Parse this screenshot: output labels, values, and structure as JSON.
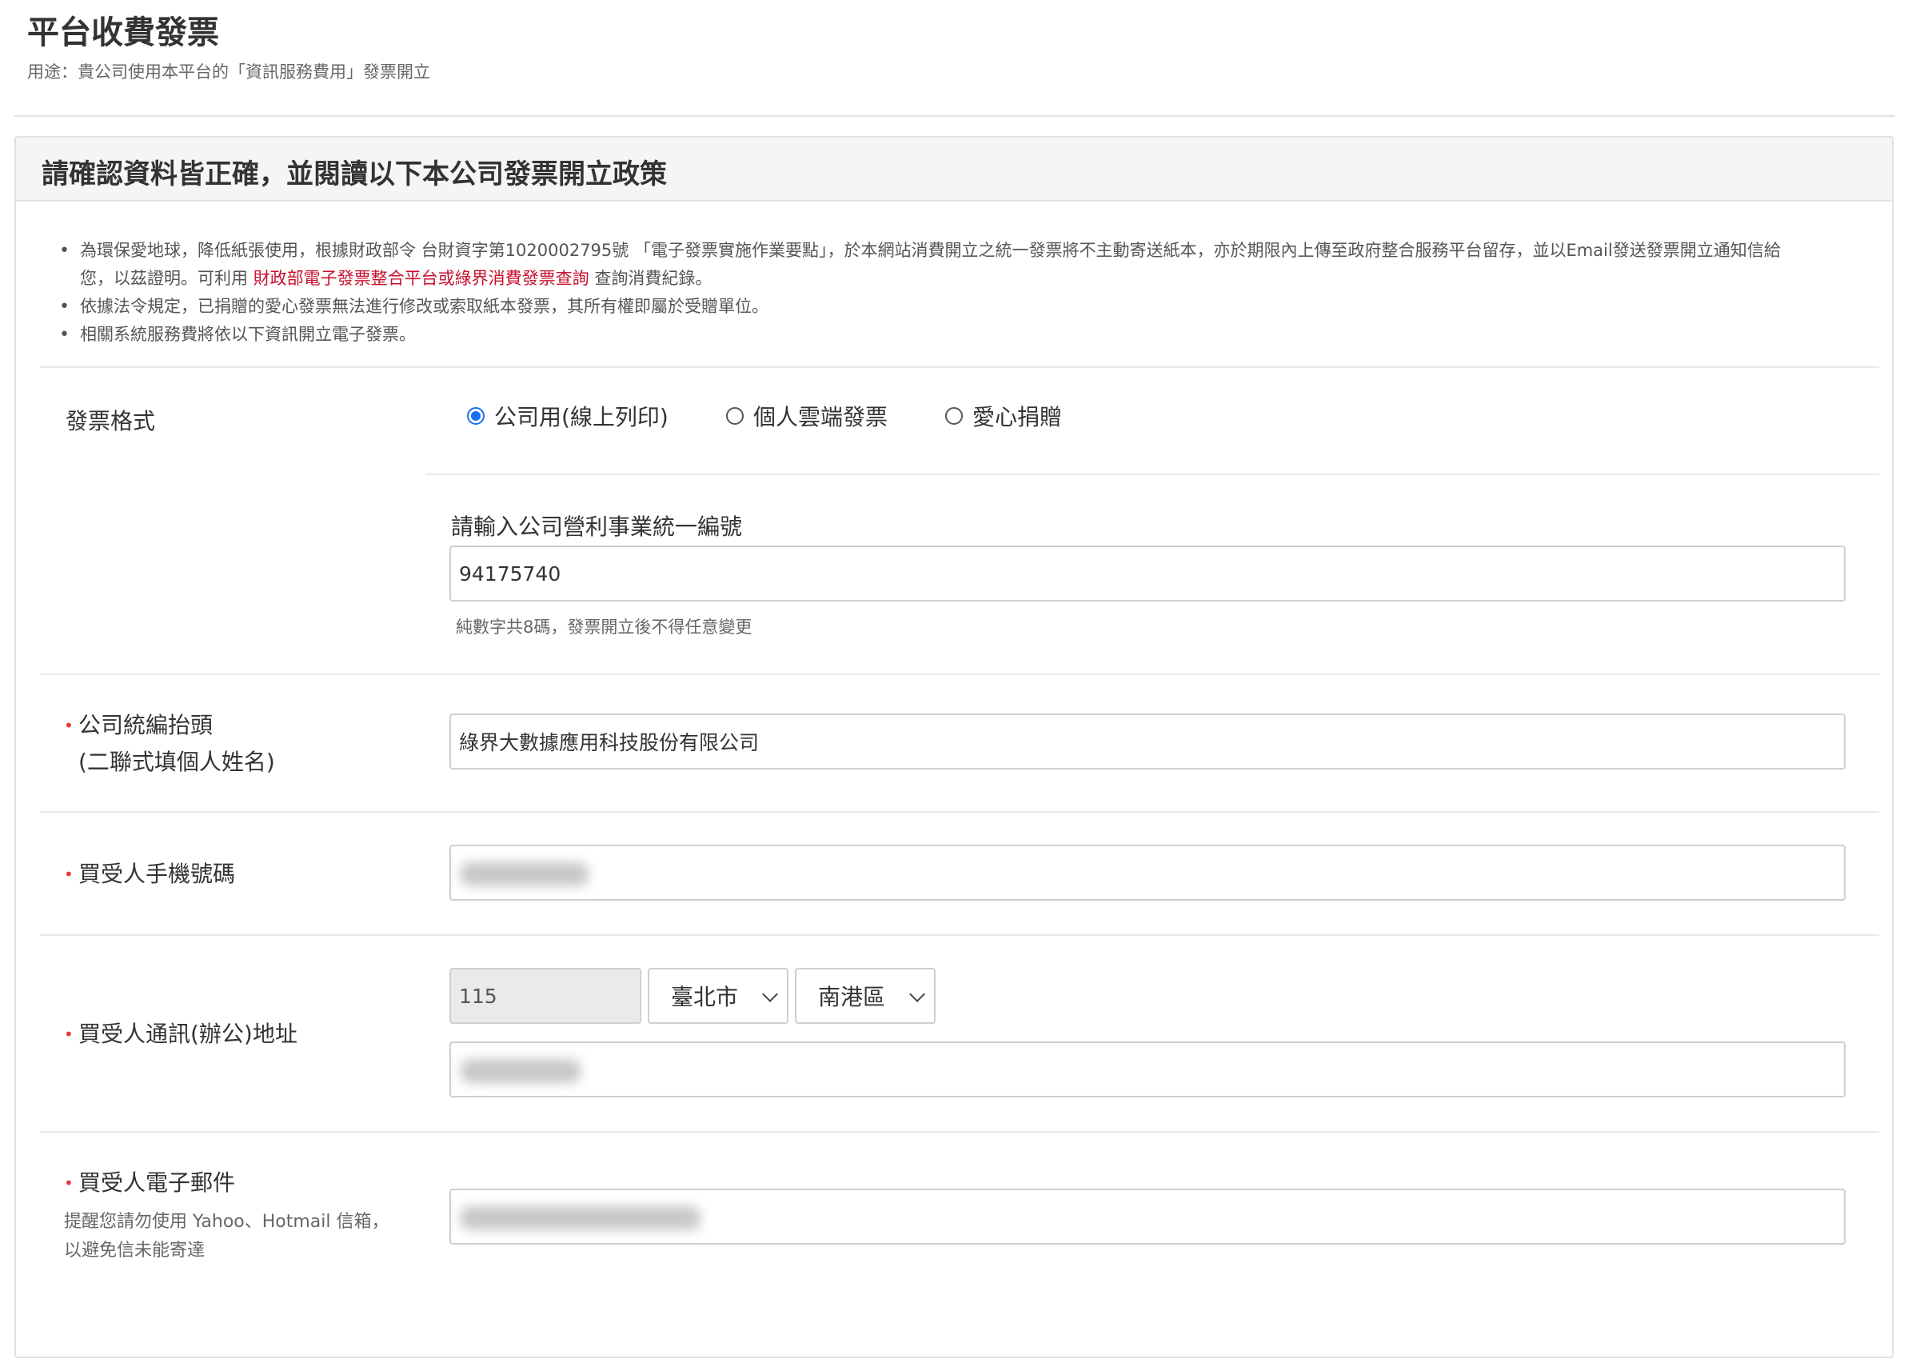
{
  "header": {
    "title": "平台收費發票",
    "subtitle": "用途：貴公司使用本平台的「資訊服務費用」發票開立"
  },
  "card": {
    "title": "請確認資料皆正確，並閱讀以下本公司發票開立政策",
    "policy": {
      "item1_line1": "為環保愛地球，降低紙張使用，根據財政部令 台財資字第1020002795號 「電子發票實施作業要點」，於本網站消費開立之統一發票將不主動寄送紙本，亦於期限內上傳至政府整合服務平台留存，並以Email發送發票開立通知信給",
      "item1_line2_pre": "您，以茲證明。可利用 ",
      "item1_link": "財政部電子發票整合平台或綠界消費發票查詢",
      "item1_line2_post": " 查詢消費紀錄。",
      "item2": "依據法令規定，已捐贈的愛心發票無法進行修改或索取紙本發票，其所有權即屬於受贈單位。",
      "item3": "相關系統服務費將依以下資訊開立電子發票。"
    }
  },
  "form": {
    "invoice_format": {
      "label": "發票格式",
      "options": [
        "公司用(線上列印)",
        "個人雲端發票",
        "愛心捐贈"
      ],
      "selected": "公司用(線上列印)"
    },
    "tax_id": {
      "label": "請輸入公司營利事業統一編號",
      "value": "94175740",
      "help": "純數字共8碼，發票開立後不得任意變更"
    },
    "company_title": {
      "required_mark": "•",
      "label_line1": "公司統編抬頭",
      "label_line2": "(二聯式填個人姓名)",
      "value": "綠界大數據應用科技股份有限公司"
    },
    "phone": {
      "required_mark": "•",
      "label": "買受人手機號碼"
    },
    "address": {
      "required_mark": "•",
      "label": "買受人通訊(辦公)地址",
      "zip": "115",
      "city": "臺北市",
      "district": "南港區"
    },
    "email": {
      "required_mark": "•",
      "label": "買受人電子郵件",
      "hint_line1": "提醒您請勿使用 Yahoo、Hotmail 信箱，",
      "hint_line2": "以避免信未能寄達"
    }
  }
}
